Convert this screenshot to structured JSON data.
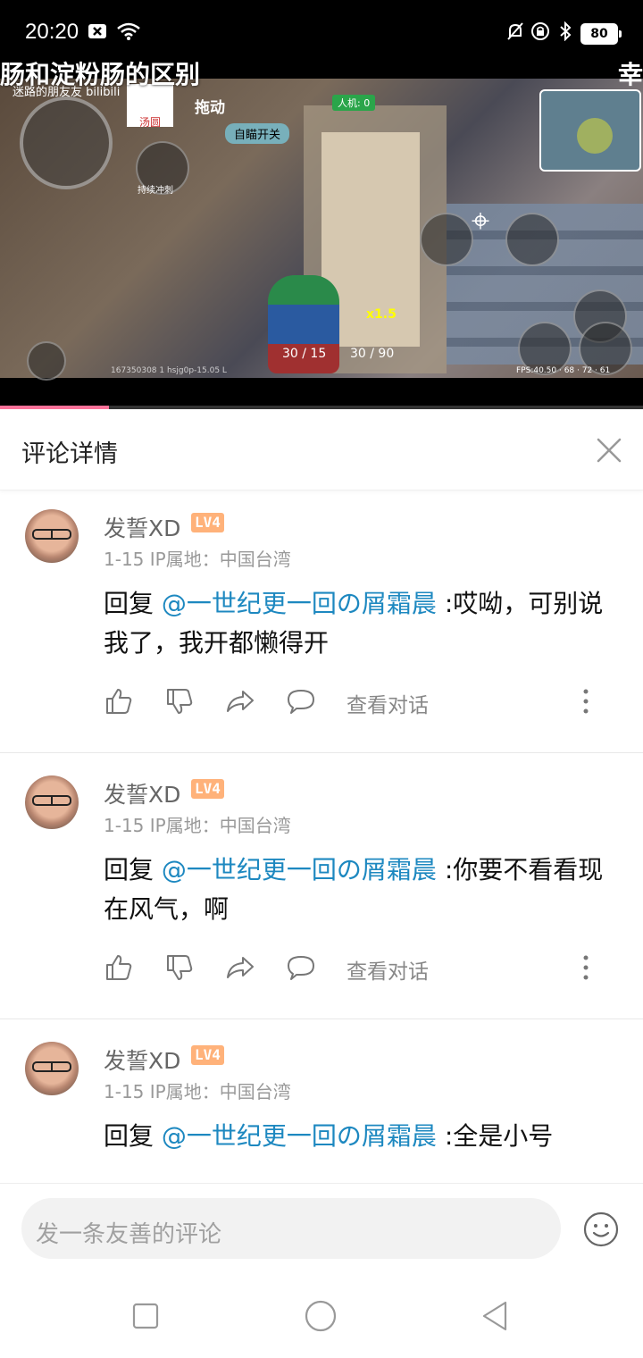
{
  "status_bar": {
    "time": "20:20",
    "battery": "80"
  },
  "video": {
    "title_left": "肠和淀粉肠的区别",
    "title_right": "幸",
    "watermark": "迷路的朋友友 bilibili",
    "sticker_label": "汤圆",
    "hud_drag": "拖动",
    "hud_auto_open": "自瞄开关",
    "hud_people": "人机: 0",
    "hud_sprint": "持续冲刺",
    "hud_ammo_1": "30 / 15",
    "hud_ammo_2": "30 / 90",
    "hud_scope": "x1.5",
    "hud_fps": "FPS:40.50 · 68 · 72 · 61",
    "hud_debug": "167350308 1 hsjg0p-15.05 L",
    "progress_percent": 17
  },
  "panel": {
    "title": "评论详情"
  },
  "comments": [
    {
      "username": "发誓XD",
      "level": "LV4",
      "meta": "1-15  IP属地：中国台湾",
      "prefix": "回复 ",
      "mention": "@一世纪更一回の屑霜晨",
      "text": " :哎呦，可别说我了，我开都懒得开",
      "view_conversation": "查看对话"
    },
    {
      "username": "发誓XD",
      "level": "LV4",
      "meta": "1-15  IP属地：中国台湾",
      "prefix": "回复 ",
      "mention": "@一世纪更一回の屑霜晨",
      "text": " :你要不看看现在风气，啊",
      "view_conversation": "查看对话"
    },
    {
      "username": "发誓XD",
      "level": "LV4",
      "meta": "1-15  IP属地：中国台湾",
      "prefix": "回复 ",
      "mention": "@一世纪更一回の屑霜晨",
      "text": " :全是小号",
      "view_conversation": "查看对话"
    }
  ],
  "input": {
    "placeholder": "发一条友善的评论"
  },
  "colors": {
    "accent": "#fb7299",
    "mention": "#1d88c0",
    "level_badge": "#ffb27a"
  }
}
